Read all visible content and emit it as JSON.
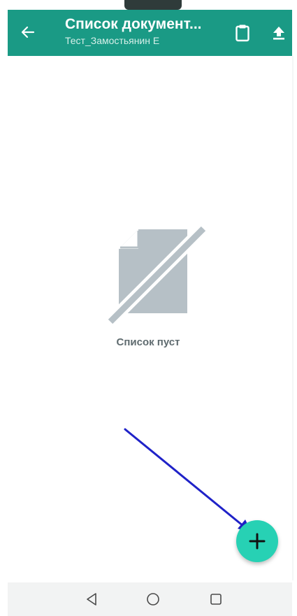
{
  "appbar": {
    "title": "Список документ...",
    "subtitle": "Тест_Замостьянин Е",
    "background": "#1a9a85",
    "icons": [
      "back-arrow-icon",
      "clipboard-icon",
      "upload-icon"
    ]
  },
  "empty_state": {
    "icon": "no-document-icon",
    "text": "Список пуст",
    "icon_color": "#b6c0c6"
  },
  "fab": {
    "icon": "plus-icon",
    "color": "#27d1b4"
  },
  "annotation": {
    "icon": "arrow-pointer",
    "color": "#1f22c8"
  },
  "system_nav": {
    "icons": [
      "nav-back-icon",
      "nav-home-icon",
      "nav-recents-icon"
    ]
  }
}
